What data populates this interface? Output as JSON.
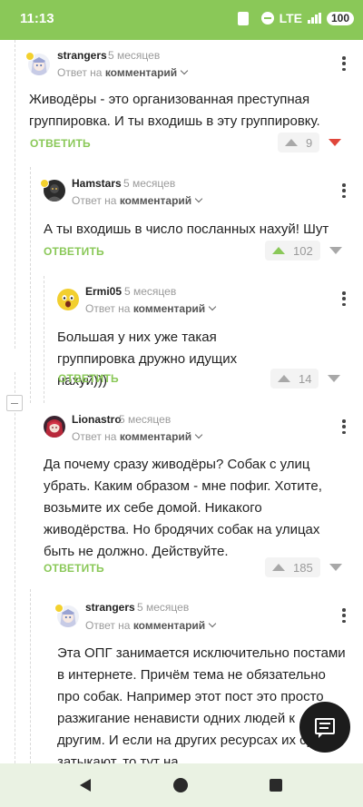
{
  "status_bar": {
    "time": "11:13",
    "network": "LTE",
    "battery": "100",
    "background_color": "#8ac858"
  },
  "labels": {
    "reply_prefix": "Ответ на",
    "reply_target": "комментарий",
    "reply_button": "ОТВЕТИТЬ"
  },
  "comments": [
    {
      "username": "strangers",
      "time": "5 месяцев",
      "text": "Живодёры - это организованная преступная группировка. И ты входишь в эту группировку.",
      "rating": "9",
      "vote_state": "down",
      "avatar_icon": "anime-avatar-icon",
      "has_badge": true
    },
    {
      "username": "Hamstars",
      "time": "5 месяцев",
      "text": "А ты входишь в число посланных нахуй! Шут",
      "rating": "102",
      "vote_state": "up",
      "avatar_icon": "dark-avatar-icon",
      "has_badge": true
    },
    {
      "username": "Ermi05",
      "time": "5 месяцев",
      "text": "Большая у них уже такая группировка дружно идущих нахуй)))",
      "rating": "14",
      "vote_state": "none",
      "avatar_icon": "yellow-face-avatar-icon",
      "has_badge": false
    },
    {
      "username": "Lionastro",
      "time": "5 месяцев",
      "text": "Да почему сразу живодёры? Собак с улиц убрать. Каким образом - мне пофиг. Хотите, возьмите их себе домой. Никакого живодёрства. Но бродячих собак на улицах быть не должно. Действуйте.",
      "rating": "185",
      "vote_state": "none",
      "avatar_icon": "red-hair-avatar-icon",
      "has_badge": false
    },
    {
      "username": "strangers",
      "time": "5 месяцев",
      "text": "Эта ОПГ занимается исключительно постами в интернете. Причём тема не обязательно про собак. Например этот пост это просто разжигание ненависти одних людей к другим. И если на других ресурсах их сразу затыкают, то тут на",
      "avatar_icon": "anime-avatar-icon",
      "has_badge": true
    }
  ],
  "fab": {
    "icon": "comment-icon"
  },
  "navigation": {
    "back_icon": "back-icon",
    "home_icon": "home-icon",
    "recents_icon": "recents-icon"
  },
  "colors": {
    "accent": "#8ac858",
    "downvote_active": "#e0463b",
    "muted_text": "#9a9a9a"
  }
}
